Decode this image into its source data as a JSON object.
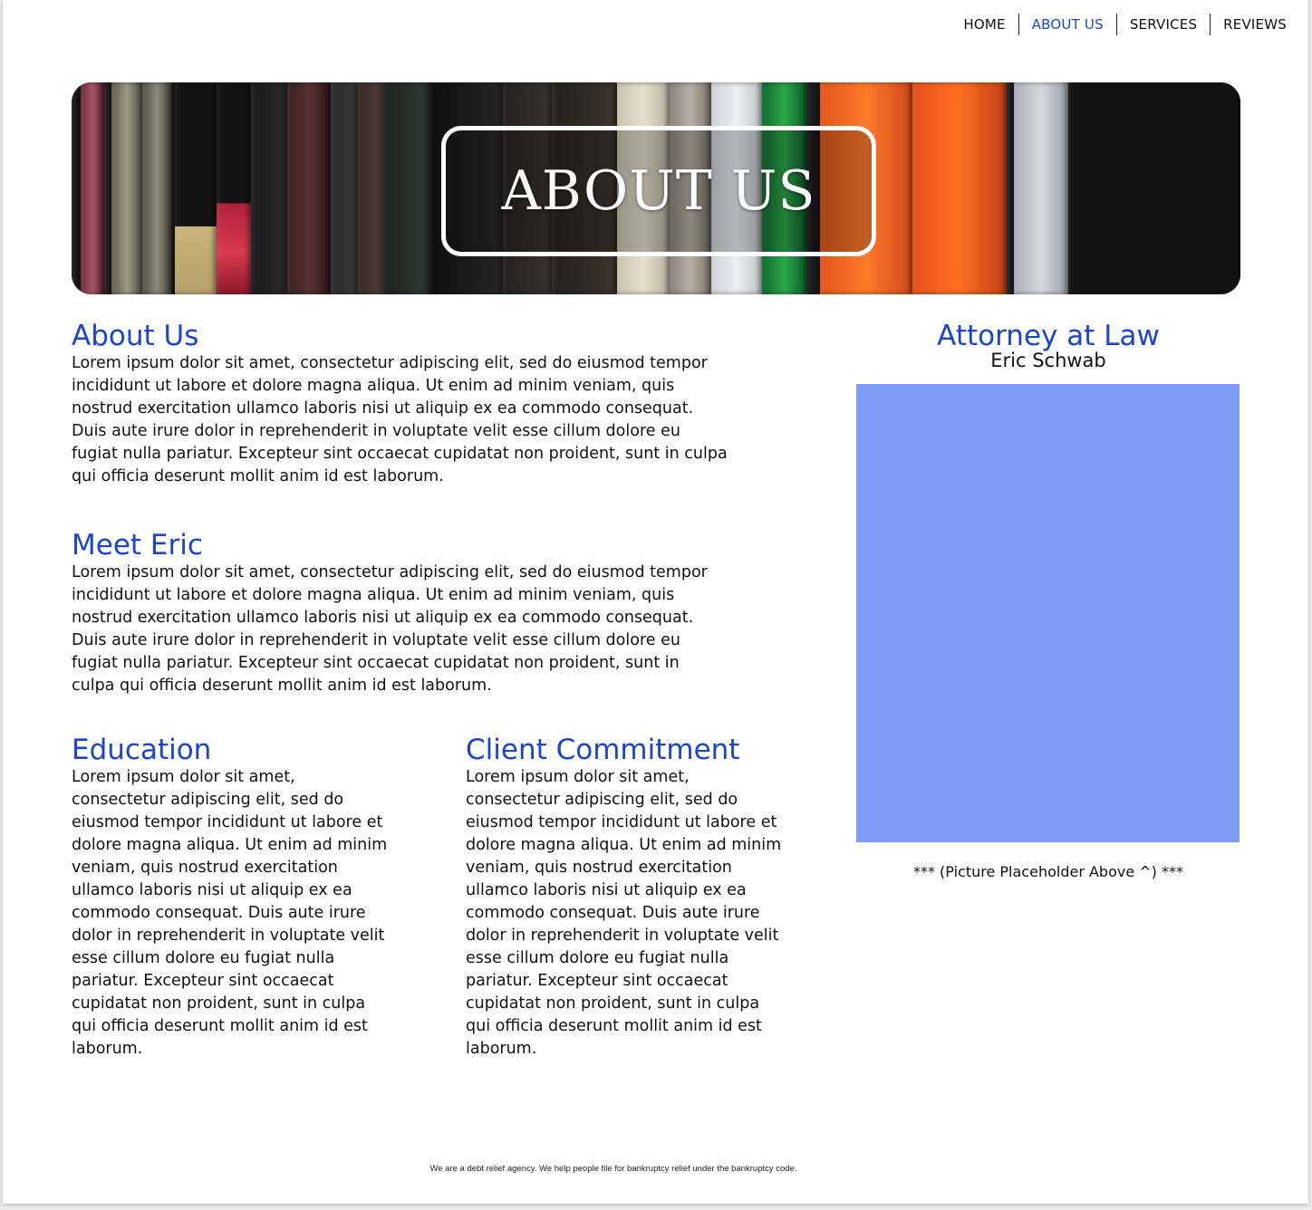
{
  "nav": {
    "items": [
      {
        "label": "HOME",
        "active": false
      },
      {
        "label": "ABOUT US",
        "active": true
      },
      {
        "label": "SERVICES",
        "active": false
      },
      {
        "label": "REVIEWS",
        "active": false
      }
    ],
    "active_color": "#1a44d6"
  },
  "hero": {
    "title": "ABOUT US"
  },
  "sections": {
    "about": {
      "heading": "About Us",
      "body": "Lorem ipsum dolor sit amet, consectetur adipiscing elit, sed do eiusmod tempor incididunt ut labore et dolore magna aliqua. Ut enim ad minim veniam, quis nostrud exercitation ullamco laboris nisi ut aliquip ex ea commodo consequat. Duis aute irure dolor in reprehenderit in voluptate velit esse cillum dolore eu fugiat nulla pariatur. Excepteur sint occaecat cupidatat non proident, sunt in culpa qui officia deserunt mollit anim id est laborum."
    },
    "meet_eric": {
      "heading": "Meet Eric",
      "body": "Lorem ipsum dolor sit amet, consectetur adipiscing elit, sed do eiusmod tempor incididunt ut labore et dolore magna aliqua. Ut enim ad minim veniam, quis nostrud exercitation ullamco laboris nisi ut aliquip ex ea commodo consequat. Duis aute irure dolor in reprehenderit in voluptate velit esse cillum dolore eu fugiat nulla pariatur. Excepteur sint occaecat cupidatat non proident, sunt in culpa qui officia deserunt mollit anim id est laborum."
    },
    "education": {
      "heading": "Education",
      "body": "Lorem ipsum dolor sit amet, consectetur adipiscing elit, sed do eiusmod tempor incididunt ut labore et dolore magna aliqua. Ut enim ad minim veniam, quis nostrud exercitation ullamco laboris nisi ut aliquip ex ea commodo consequat. Duis aute irure dolor in reprehenderit in voluptate velit esse cillum dolore eu fugiat nulla pariatur. Excepteur sint occaecat cupidatat non proident, sunt in culpa qui officia deserunt mollit anim id est laborum."
    },
    "client_commitment": {
      "heading": "Client Commitment",
      "body": "Lorem ipsum dolor sit amet, consectetur adipiscing elit, sed do eiusmod tempor incididunt ut labore et dolore magna aliqua. Ut enim ad minim veniam, quis nostrud exercitation ullamco laboris nisi ut aliquip ex ea commodo consequat. Duis aute irure dolor in reprehenderit in voluptate velit esse cillum dolore eu fugiat nulla pariatur. Excepteur sint occaecat cupidatat non proident, sunt in culpa qui officia deserunt mollit anim id est laborum."
    }
  },
  "sidebar": {
    "title": "Attorney at Law",
    "name": "Eric Schwab",
    "placeholder_color": "#7f9bf8",
    "caption": "*** (Picture Placeholder Above ^) ***"
  },
  "footer": {
    "text": "We are a debt relief agency. We help people file for bankruptcy relief under the bankruptcy code."
  }
}
